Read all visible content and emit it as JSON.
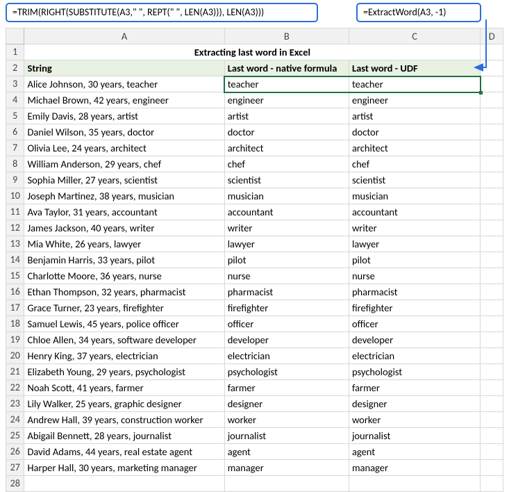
{
  "formula_left": "=TRIM(RIGHT(SUBSTITUTE(A3,\" \", REPT(\" \", LEN(A3))), LEN(A3)))",
  "formula_right": "=ExtractWord(A3, -1)",
  "columns": [
    "A",
    "B",
    "C",
    "D"
  ],
  "title": "Extracting last word in Excel",
  "headers": {
    "a": "String",
    "b": "Last word - native formula",
    "c": "Last word - UDF"
  },
  "chart_data": {
    "type": "table",
    "title": "Extracting last word in Excel",
    "columns": [
      "String",
      "Last word - native formula",
      "Last word - UDF"
    ],
    "rows": [
      [
        "Alice Johnson, 30 years, teacher",
        "teacher",
        "teacher"
      ],
      [
        "Michael Brown, 42 years, engineer",
        "engineer",
        "engineer"
      ],
      [
        "Emily Davis, 28 years, artist",
        "artist",
        "artist"
      ],
      [
        "Daniel Wilson, 35 years, doctor",
        "doctor",
        "doctor"
      ],
      [
        "Olivia Lee, 24 years, architect",
        "architect",
        "architect"
      ],
      [
        "William Anderson, 29 years, chef",
        "chef",
        "chef"
      ],
      [
        "Sophia Miller, 27 years, scientist",
        "scientist",
        "scientist"
      ],
      [
        "Joseph Martinez, 38 years, musician",
        "musician",
        "musician"
      ],
      [
        "Ava Taylor, 31 years, accountant",
        "accountant",
        "accountant"
      ],
      [
        "James Jackson, 40 years, writer",
        "writer",
        "writer"
      ],
      [
        "Mia White, 26 years, lawyer",
        "lawyer",
        "lawyer"
      ],
      [
        "Benjamin Harris, 33 years, pilot",
        "pilot",
        "pilot"
      ],
      [
        "Charlotte Moore, 36 years, nurse",
        "nurse",
        "nurse"
      ],
      [
        "Ethan Thompson, 32 years, pharmacist",
        "pharmacist",
        "pharmacist"
      ],
      [
        "Grace Turner, 23 years, firefighter",
        "firefighter",
        "firefighter"
      ],
      [
        "Samuel Lewis, 45 years, police officer",
        "officer",
        "officer"
      ],
      [
        "Chloe Allen, 34 years, software developer",
        "developer",
        "developer"
      ],
      [
        "Henry King, 37 years, electrician",
        "electrician",
        "electrician"
      ],
      [
        "Elizabeth Young, 29 years, psychologist",
        "psychologist",
        "psychologist"
      ],
      [
        "Noah Scott, 41 years, farmer",
        "farmer",
        "farmer"
      ],
      [
        "Lily Walker, 25 years, graphic designer",
        "designer",
        "designer"
      ],
      [
        "Andrew Hall, 39 years, construction worker",
        "worker",
        "worker"
      ],
      [
        "Abigail Bennett, 28 years, journalist",
        "journalist",
        "journalist"
      ],
      [
        "David Adams, 44 years, real estate agent",
        "agent",
        "agent"
      ],
      [
        "Harper Hall, 30 years, marketing manager",
        "manager",
        "manager"
      ]
    ]
  }
}
